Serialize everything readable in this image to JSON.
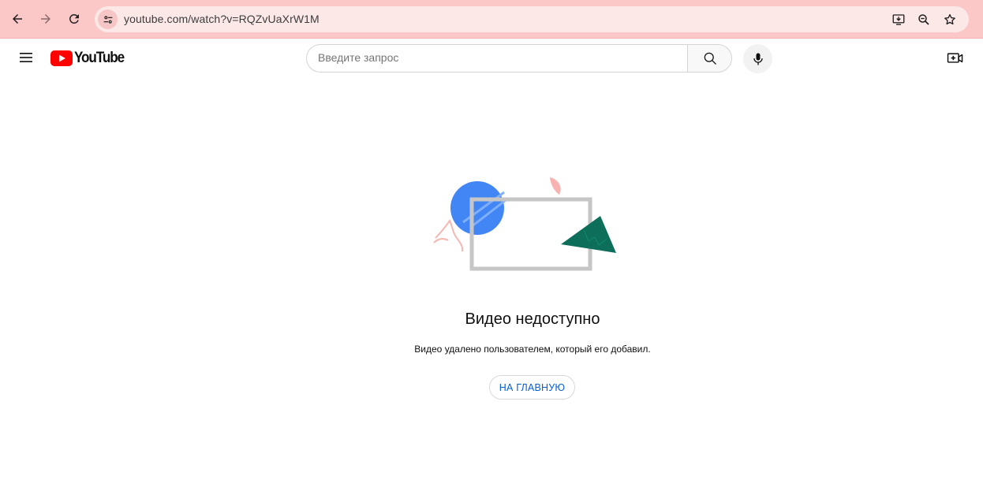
{
  "browser": {
    "url": "youtube.com/watch?v=RQZvUaXrW1M",
    "icons": [
      "back-icon",
      "forward-icon",
      "reload-icon",
      "site-info-icon",
      "install-app-icon",
      "zoom-icon",
      "bookmark-star-icon"
    ],
    "theme_color": "#fcc7c7"
  },
  "header": {
    "logo_text": "YouTube",
    "logo_color": "#ff0000",
    "search_placeholder": "Введите запрос",
    "icons": [
      "menu-icon",
      "search-icon",
      "mic-icon",
      "create-video-icon"
    ]
  },
  "error": {
    "title": "Видео недоступно",
    "message": "Видео удалено пользователем, который его добавил.",
    "button_label": "НА ГЛАВНУЮ",
    "button_color": "#065fd4"
  }
}
